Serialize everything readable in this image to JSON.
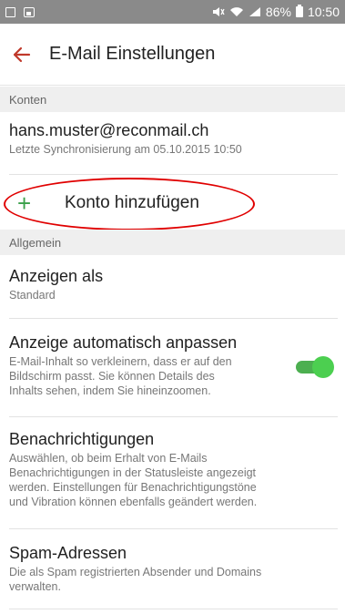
{
  "statusbar": {
    "battery": "86%",
    "time": "10:50"
  },
  "appbar": {
    "title": "E-Mail Einstellungen"
  },
  "sections": {
    "accounts": "Konten",
    "general": "Allgemein"
  },
  "account": {
    "email": "hans.muster@reconmail.ch",
    "sync": "Letzte Synchronisierung am 05.10.2015 10:50"
  },
  "add_account": {
    "label": "Konto hinzufügen",
    "plus": "+"
  },
  "settings": {
    "display_as": {
      "title": "Anzeigen als",
      "value": "Standard"
    },
    "auto_fit": {
      "title": "Anzeige automatisch anpassen",
      "summary_1": "E-Mail-Inhalt so verkleinern, dass er auf den",
      "summary_2": "Bildschirm passt. Sie können Details des",
      "summary_3": "Inhalts sehen, indem Sie hineinzoomen.",
      "enabled": true
    },
    "notifications": {
      "title": "Benachrichtigungen",
      "summary_1": "Auswählen, ob beim Erhalt von E-Mails",
      "summary_2": "Benachrichtigungen in der Statusleiste angezeigt",
      "summary_3": "werden. Einstellungen für Benachrichtigungstöne",
      "summary_4": "und Vibration können ebenfalls geändert werden."
    },
    "spam": {
      "title": "Spam-Adressen",
      "summary_1": "Die als Spam registrierten Absender und Domains",
      "summary_2": "verwalten."
    }
  },
  "colors": {
    "accent": "#4caf50",
    "back_arrow": "#c0392b",
    "highlight": "#e00000"
  }
}
